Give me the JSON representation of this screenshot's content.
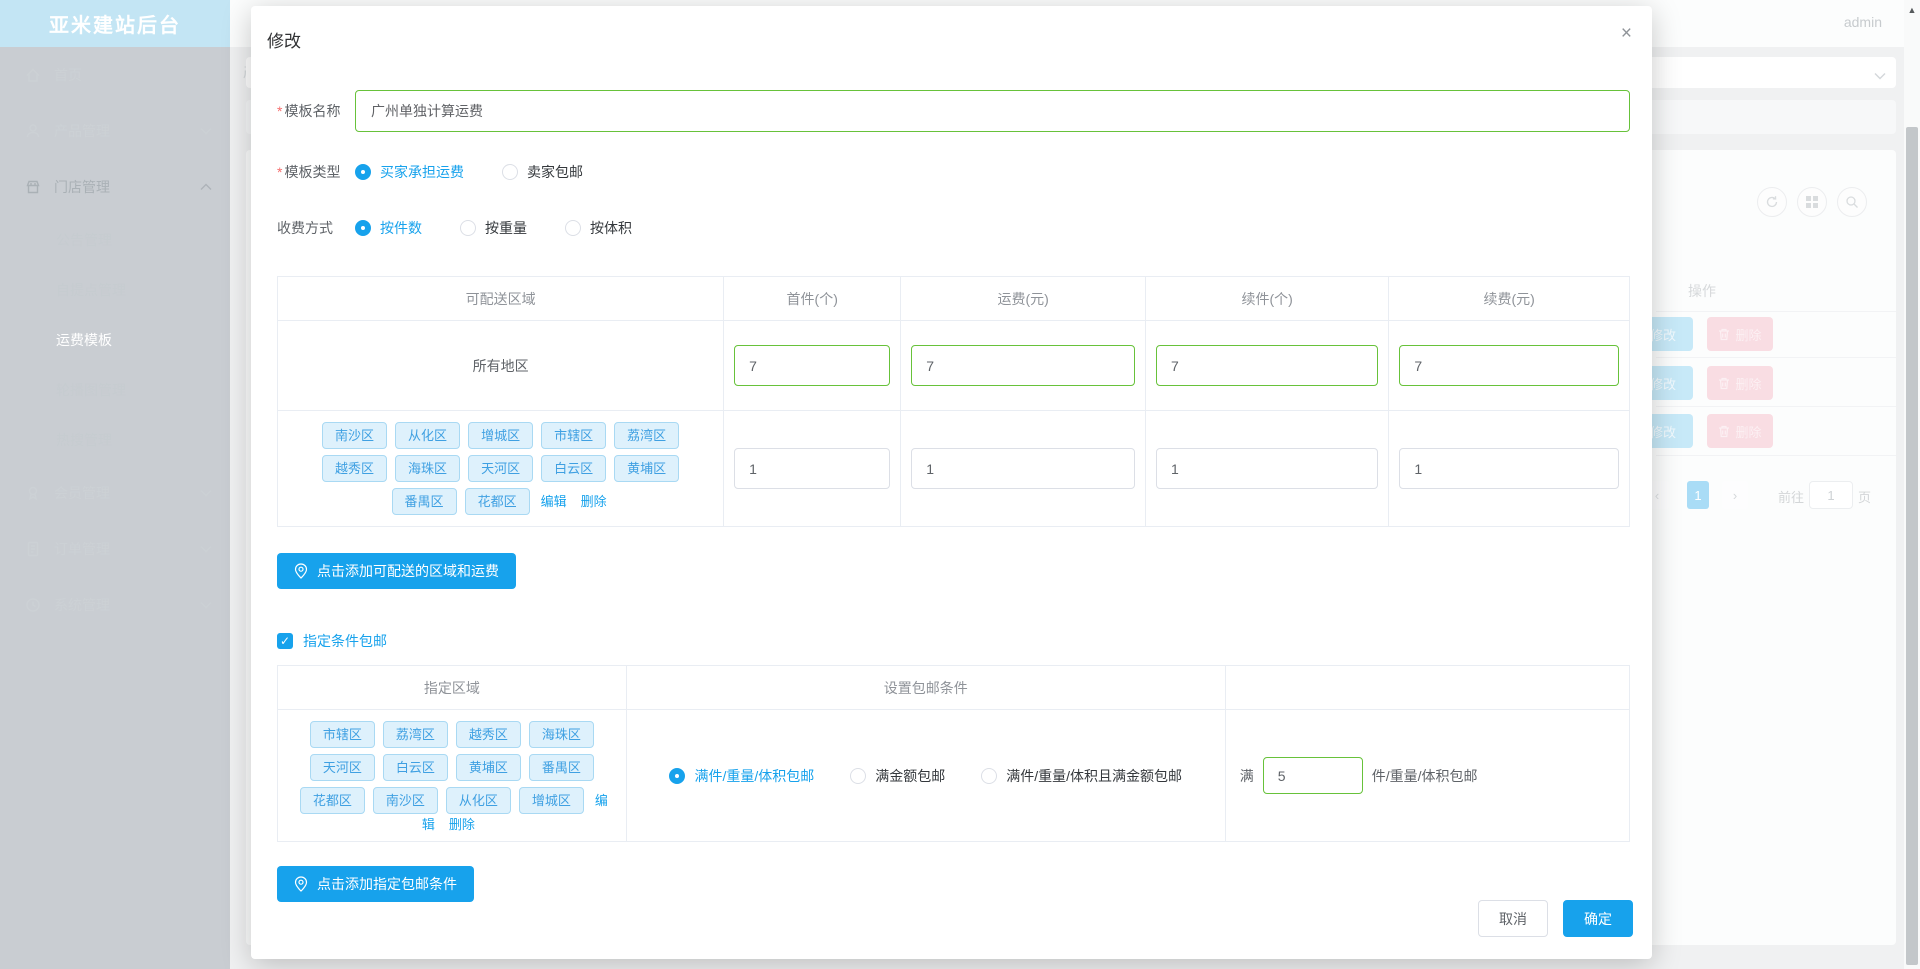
{
  "app": {
    "logo_title": "亚米建站后台",
    "username": "admin",
    "partial_header_text": "产"
  },
  "icons": {
    "check": "✓",
    "scroll_up": "▲",
    "close": "×"
  },
  "sidebar": {
    "items": [
      {
        "label": "首页"
      },
      {
        "label": "产品管理"
      },
      {
        "label": "门店管理"
      },
      {
        "label": "会员管理"
      },
      {
        "label": "订单管理"
      },
      {
        "label": "系统管理"
      }
    ],
    "store_children": [
      {
        "label": "公告管理"
      },
      {
        "label": "自提点管理"
      },
      {
        "label": "运费模板"
      },
      {
        "label": "轮播图管理"
      },
      {
        "label": "热搜管理"
      }
    ]
  },
  "bg_table": {
    "ops_header": "操作",
    "edit_label": "修改",
    "delete_label": "删除",
    "pagination": {
      "prev": "‹",
      "current": "1",
      "next": "›",
      "goto_label": "前往",
      "goto_value": "1",
      "page_label": "页"
    }
  },
  "modal": {
    "title": "修改",
    "name_field": {
      "label": "模板名称",
      "value": "广州单独计算运费"
    },
    "type_field": {
      "label": "模板类型",
      "options": [
        "买家承担运费",
        "卖家包邮"
      ],
      "selected": "买家承担运费"
    },
    "fee_field": {
      "label": "收费方式",
      "options": [
        "按件数",
        "按重量",
        "按体积"
      ],
      "selected": "按件数"
    },
    "ship_table": {
      "headers": [
        "可配送区域",
        "首件(个)",
        "运费(元)",
        "续件(个)",
        "续费(元)"
      ],
      "row_all": {
        "region": "所有地区",
        "values": [
          "7",
          "7",
          "7",
          "7"
        ]
      },
      "row_tags": {
        "tags": [
          "南沙区",
          "从化区",
          "增城区",
          "市辖区",
          "荔湾区",
          "越秀区",
          "海珠区",
          "天河区",
          "白云区",
          "黄埔区",
          "番禺区",
          "花都区"
        ],
        "edit_link": "编辑",
        "delete_link": "删除",
        "values": [
          "1",
          "1",
          "1",
          "1"
        ]
      }
    },
    "add_region_button": "点击添加可配送的区域和运费",
    "free_shipping": {
      "checkbox_label": "指定条件包邮",
      "checked": true,
      "headers": [
        "指定区域",
        "设置包邮条件",
        ""
      ],
      "tags": [
        "市辖区",
        "荔湾区",
        "越秀区",
        "海珠区",
        "天河区",
        "白云区",
        "黄埔区",
        "番禺区",
        "花都区",
        "南沙区",
        "从化区",
        "增城区"
      ],
      "edit_link": "编辑",
      "delete_link": "删除",
      "condition_options": [
        "满件/重量/体积包邮",
        "满金额包邮",
        "满件/重量/体积且满金额包邮"
      ],
      "selected_condition": "满件/重量/体积包邮",
      "threshold": {
        "prefix": "满",
        "value": "5",
        "suffix": "件/重量/体积包邮"
      }
    },
    "add_condition_button": "点击添加指定包邮条件",
    "cancel_label": "取消",
    "confirm_label": "确定"
  },
  "colors": {
    "primary": "#17a2ec",
    "success_border": "#67c23a",
    "tag_bg": "#def1fc",
    "tag_border": "#a9d9f3",
    "tag_text": "#3fa0e2"
  }
}
